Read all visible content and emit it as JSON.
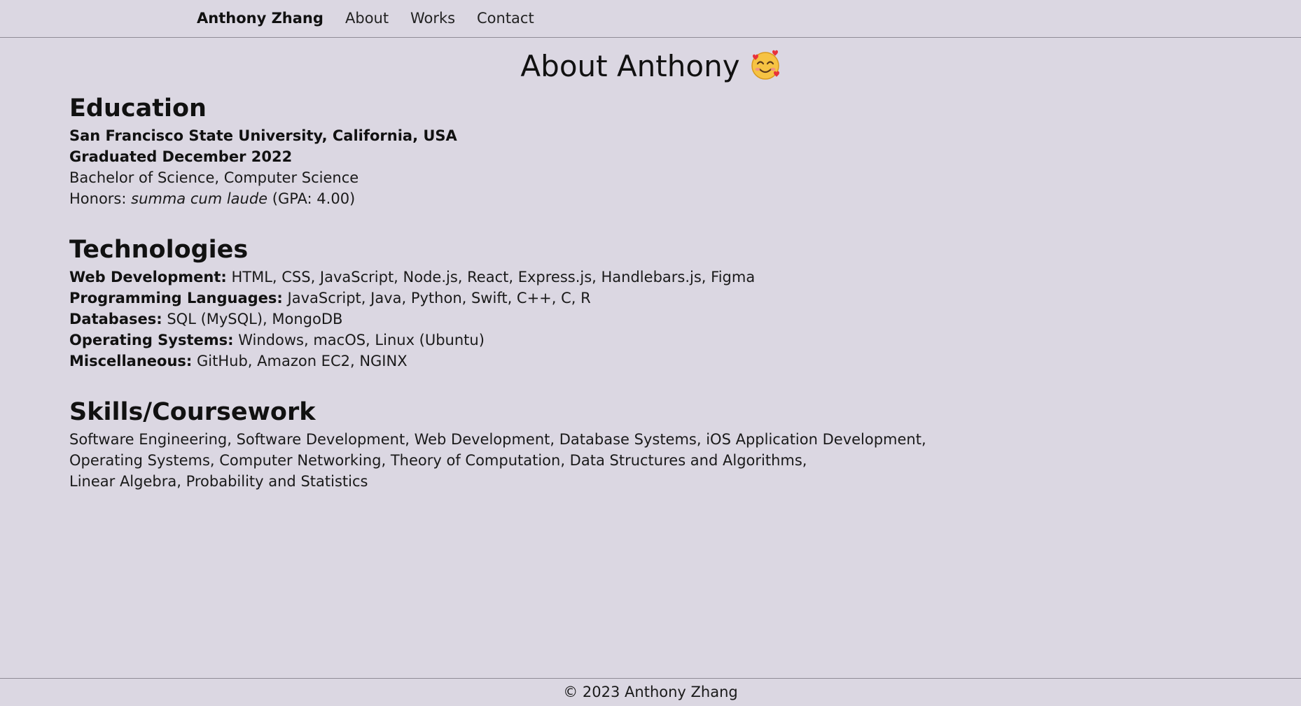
{
  "nav": {
    "brand": "Anthony Zhang",
    "links": [
      "About",
      "Works",
      "Contact"
    ]
  },
  "page": {
    "title": "About Anthony",
    "title_icon": "smiling-face-with-hearts-emoji"
  },
  "education": {
    "heading": "Education",
    "school": "San Francisco State University, California, USA",
    "graduated": "Graduated December 2022",
    "degree": "Bachelor of Science, Computer Science",
    "honors_label": "Honors: ",
    "honors_value": "summa cum laude",
    "honors_gpa": " (GPA: 4.00)"
  },
  "technologies": {
    "heading": "Technologies",
    "items": [
      {
        "label": "Web Development:",
        "value": " HTML, CSS, JavaScript, Node.js, React, Express.js, Handlebars.js, Figma"
      },
      {
        "label": "Programming Languages:",
        "value": " JavaScript, Java, Python, Swift, C++, C, R"
      },
      {
        "label": "Databases:",
        "value": " SQL (MySQL), MongoDB"
      },
      {
        "label": "Operating Systems:",
        "value": " Windows, macOS, Linux (Ubuntu)"
      },
      {
        "label": "Miscellaneous:",
        "value": " GitHub, Amazon EC2, NGINX"
      }
    ]
  },
  "skills": {
    "heading": "Skills/Coursework",
    "lines": [
      "Software Engineering, Software Development, Web Development, Database Systems, iOS Application Development,",
      "Operating Systems, Computer Networking, Theory of Computation, Data Structures and Algorithms,",
      "Linear Algebra, Probability and Statistics"
    ]
  },
  "footer": {
    "text": "© 2023 Anthony Zhang"
  },
  "colors": {
    "background": "#dbd7e2",
    "divider": "#8f8b96",
    "text": "#111111"
  }
}
